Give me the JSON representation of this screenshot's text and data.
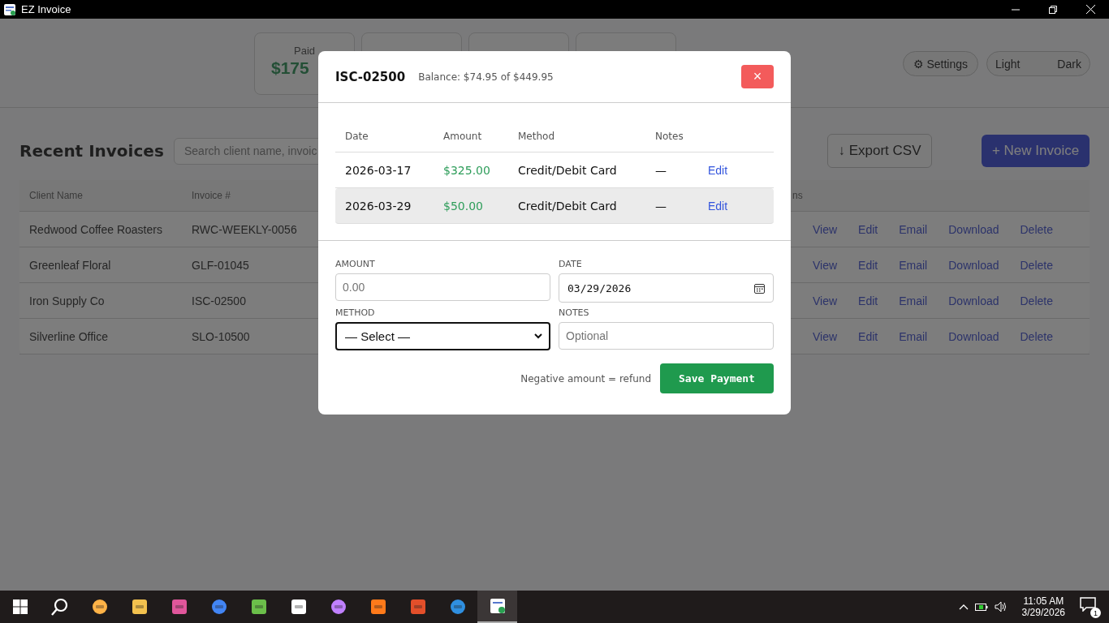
{
  "window": {
    "title": "EZ Invoice"
  },
  "stats": [
    {
      "kind": "figure",
      "label": "Paid",
      "value": "$175"
    },
    {
      "kind": "covered"
    },
    {
      "kind": "covered"
    },
    {
      "kind": "covered"
    }
  ],
  "settings_button": "⚙ Settings",
  "theme_toggle": {
    "light": "Light",
    "dark": "Dark"
  },
  "invoices": {
    "title": "Recent Invoices",
    "search": {
      "placeholder": "Search client name, invoic"
    },
    "export_button": "↓ Export CSV",
    "new_button": "+ New Invoice",
    "columns": [
      "Client Name",
      "Invoice #",
      "ns"
    ],
    "rows": [
      {
        "client": "Redwood Coffee Roasters",
        "invoice": "RWC-WEEKLY-0056",
        "actions": [
          "View",
          "Edit",
          "Email",
          "Download",
          "Delete"
        ]
      },
      {
        "client": "Greenleaf Floral",
        "invoice": "GLF-01045",
        "actions": [
          "View",
          "Edit",
          "Email",
          "Download",
          "Delete"
        ]
      },
      {
        "client": "Iron Supply Co",
        "invoice": "ISC-02500",
        "actions": [
          "View",
          "Edit",
          "Email",
          "Download",
          "Delete"
        ]
      },
      {
        "client": "Silverline Office",
        "invoice": "SLO-10500",
        "actions": [
          "View",
          "Edit",
          "Email",
          "Download",
          "Delete"
        ]
      }
    ]
  },
  "dialog": {
    "title": "ISC-02500",
    "balance": "Balance: $74.95 of $449.95",
    "close": "×",
    "columns": [
      "Date",
      "Amount",
      "Method",
      "Notes"
    ],
    "payments": [
      {
        "date": "2026-03-17",
        "amount": "$325.00",
        "method": "Credit/Debit Card",
        "notes": "—",
        "action": "Edit",
        "selected": false
      },
      {
        "date": "2026-03-29",
        "amount": "$50.00",
        "method": "Credit/Debit Card",
        "notes": "—",
        "action": "Edit",
        "selected": true
      }
    ],
    "form": {
      "amount": {
        "label": "AMOUNT",
        "placeholder": "0.00"
      },
      "date": {
        "label": "DATE",
        "value": "03/29/2026"
      },
      "method": {
        "label": "METHOD",
        "value": "— Select —"
      },
      "notes": {
        "label": "NOTES",
        "placeholder": "Optional"
      }
    },
    "hint": "Negative amount = refund",
    "save_button": "Save Payment"
  },
  "taskbar": {
    "time": "11:05 AM",
    "date": "3/29/2026",
    "notifications": "1"
  }
}
